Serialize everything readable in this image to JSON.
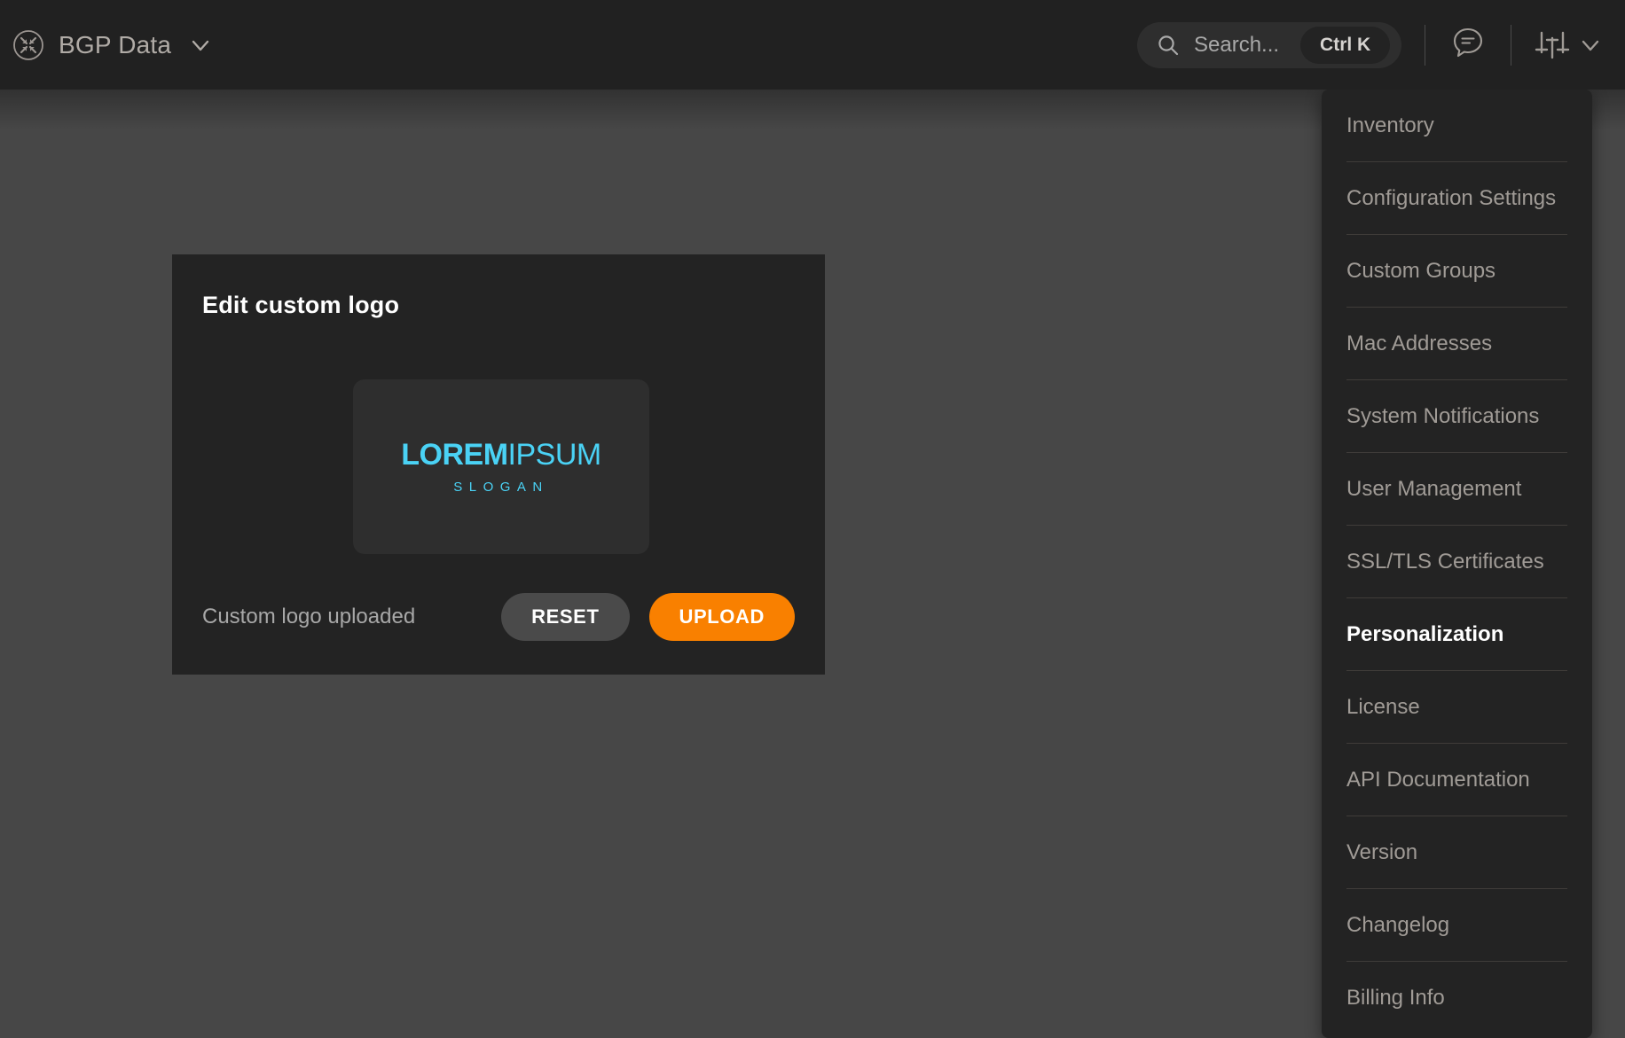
{
  "topbar": {
    "brand_icon": "collapse-arrows-circle-icon",
    "brand_title": "BGP Data",
    "brand_chevron_icon": "chevron-down-icon",
    "search": {
      "icon": "search-icon",
      "placeholder": "Search...",
      "shortcut_label": "Ctrl K"
    },
    "chat_icon": "chat-bubble-icon",
    "prefs_icon": "sliders-icon",
    "prefs_chevron_icon": "chevron-down-icon"
  },
  "logo_card": {
    "title": "Edit custom logo",
    "preview": {
      "wordmark_bold": "LOREM",
      "wordmark_light": "IPSUM",
      "slogan": "SLOGAN",
      "accent_color": "#4ad2f5"
    },
    "status_text": "Custom logo uploaded",
    "reset_label": "RESET",
    "upload_label": "UPLOAD",
    "upload_color": "#f98000",
    "reset_color": "#4a4a4a"
  },
  "settings_menu": {
    "items": [
      {
        "label": "Inventory",
        "active": false
      },
      {
        "label": "Configuration Settings",
        "active": false
      },
      {
        "label": "Custom Groups",
        "active": false
      },
      {
        "label": "Mac Addresses",
        "active": false
      },
      {
        "label": "System Notifications",
        "active": false
      },
      {
        "label": "User Management",
        "active": false
      },
      {
        "label": "SSL/TLS Certificates",
        "active": false
      },
      {
        "label": "Personalization",
        "active": true
      },
      {
        "label": "License",
        "active": false
      },
      {
        "label": "API Documentation",
        "active": false
      },
      {
        "label": "Version",
        "active": false
      },
      {
        "label": "Changelog",
        "active": false
      },
      {
        "label": "Billing Info",
        "active": false
      }
    ]
  },
  "theme": {
    "topbar_bg": "#212121",
    "content_bg": "#474747",
    "card_bg": "#232323",
    "preview_bg": "#2e2e2e",
    "muted_text": "#a09b96"
  }
}
